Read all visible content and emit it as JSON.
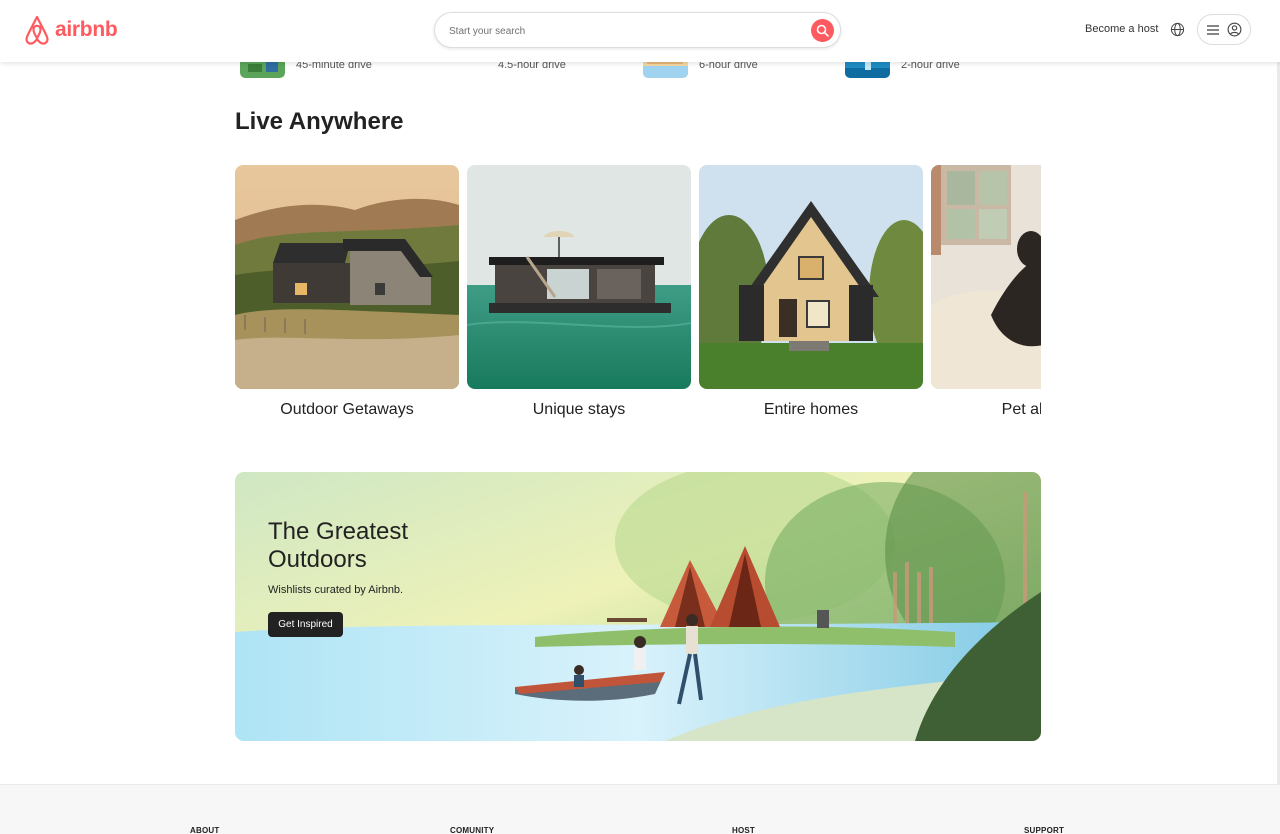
{
  "header": {
    "logo_text": "airbnb",
    "search_placeholder": "Start your search",
    "become_host": "Become a host",
    "icons": [
      "airbnb-logo-icon",
      "search-icon",
      "globe-icon",
      "hamburger-icon",
      "user-icon"
    ],
    "brand_color": "#ff5a5f"
  },
  "nearby": [
    {
      "label": "45-minute drive"
    },
    {
      "label": "4.5-hour drive",
      "image_fallback": "image"
    },
    {
      "label": "6-hour drive"
    },
    {
      "label": "2-hour drive"
    }
  ],
  "live_anywhere": {
    "title": "Live Anywhere",
    "cards": [
      {
        "label": "Outdoor Getaways"
      },
      {
        "label": "Unique stays"
      },
      {
        "label": "Entire homes"
      },
      {
        "label": "Pet allowed"
      }
    ]
  },
  "banner": {
    "title": "The Greatest Outdoors",
    "subtitle": "Wishlists curated by Airbnb.",
    "button": "Get Inspired"
  },
  "footer": {
    "columns": [
      "ABOUT",
      "COMUNITY",
      "HOST",
      "SUPPORT"
    ]
  }
}
